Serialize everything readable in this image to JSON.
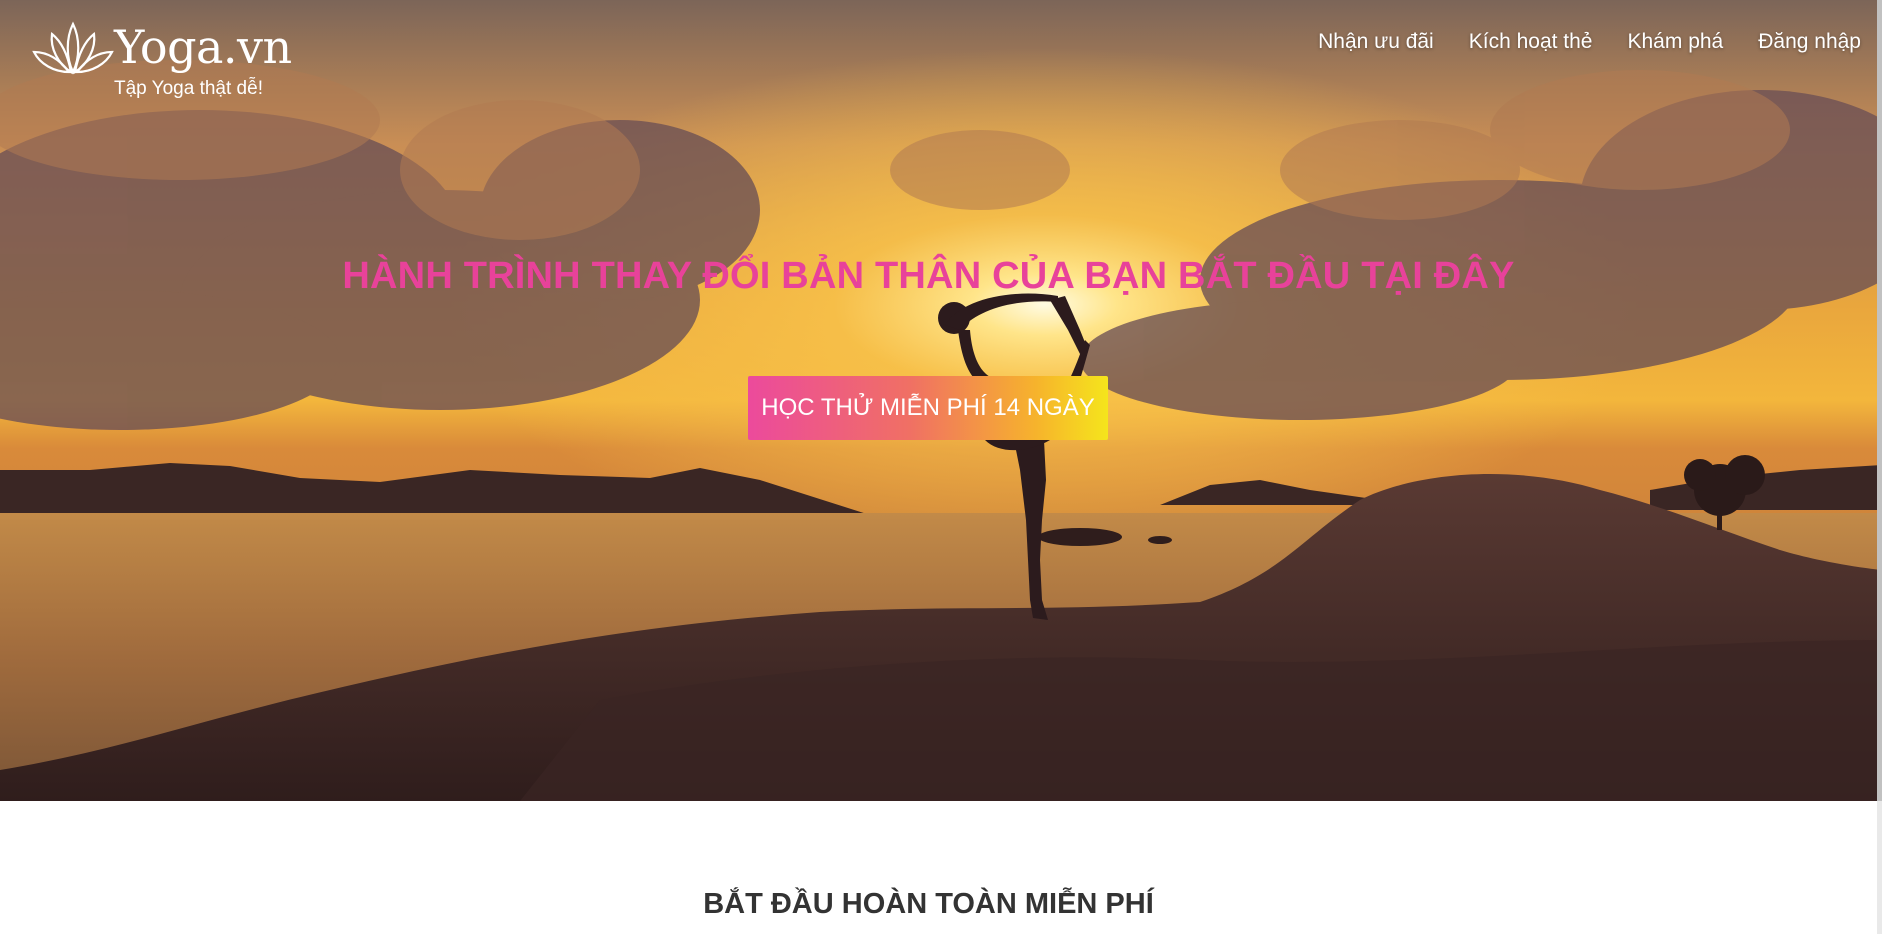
{
  "brand": {
    "name": "Yoga.vn",
    "tagline": "Tập Yoga thật dễ!",
    "logo_icon": "lotus-icon"
  },
  "nav": {
    "items": [
      {
        "label": "Nhận ưu đãi"
      },
      {
        "label": "Kích hoạt thẻ"
      },
      {
        "label": "Khám phá"
      },
      {
        "label": "Đăng nhập"
      }
    ]
  },
  "hero": {
    "headline": "HÀNH TRÌNH THAY ĐỔI BẢN THÂN CỦA BẠN BẮT ĐẦU TẠI ĐÂY",
    "cta_label": "HỌC THỬ MIỄN PHÍ 14 NGÀY",
    "image": "yoga-sunset-silhouette"
  },
  "section": {
    "title": "BẮT ĐẦU HOÀN TOÀN MIỄN PHÍ"
  },
  "colors": {
    "headline": "#e8429a",
    "cta_gradient_start": "#ec4a9c",
    "cta_gradient_end": "#f5e51c",
    "section_title": "#333333"
  }
}
